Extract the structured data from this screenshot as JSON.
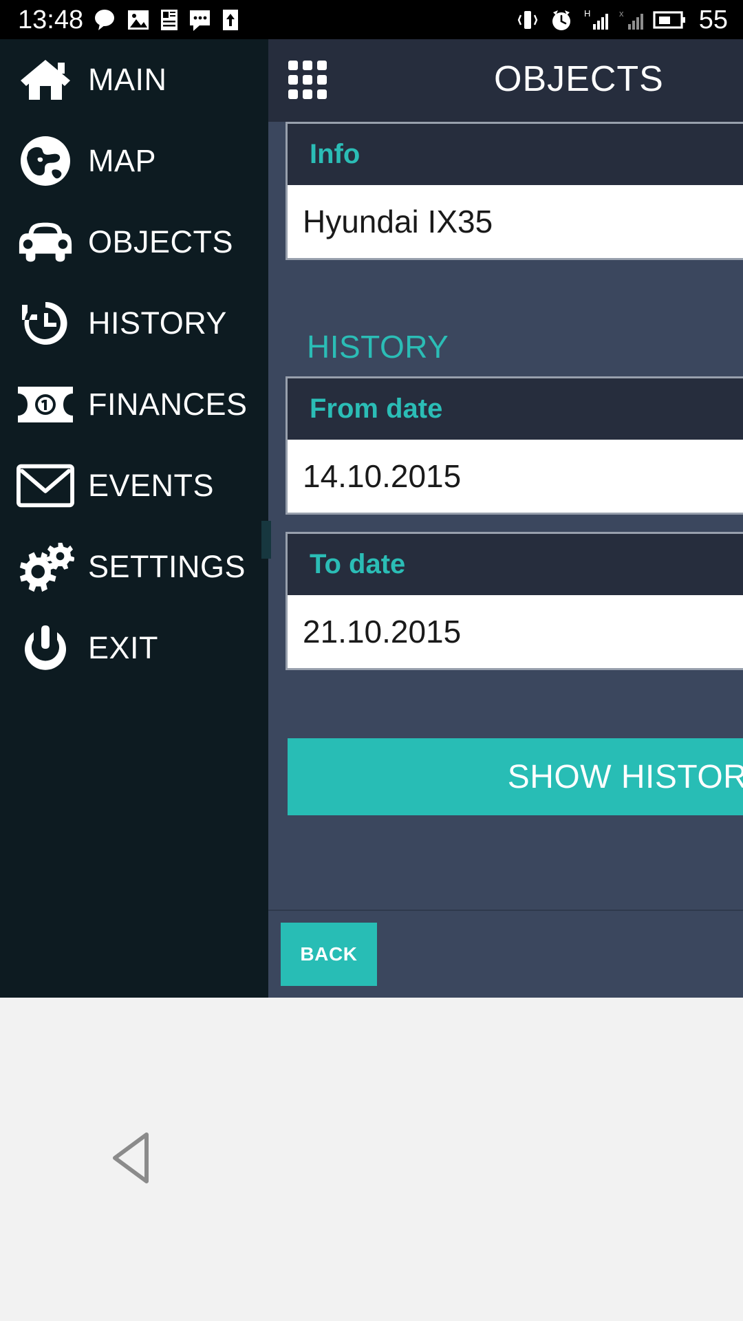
{
  "status_bar": {
    "time": "13:48",
    "battery_level": "55",
    "left_icons": [
      "chat-bubble-icon",
      "image-icon",
      "note-icon",
      "sms-icon",
      "upload-icon"
    ],
    "right_icons": [
      "vibrate-icon",
      "alarm-icon",
      "signal-h-icon",
      "signal-x-icon",
      "battery-icon"
    ]
  },
  "sidebar": {
    "items": [
      {
        "label": "MAIN",
        "icon": "home-icon"
      },
      {
        "label": "MAP",
        "icon": "globe-icon"
      },
      {
        "label": "OBJECTS",
        "icon": "car-icon"
      },
      {
        "label": "HISTORY",
        "icon": "history-clock-icon"
      },
      {
        "label": "FINANCES",
        "icon": "banknote-icon"
      },
      {
        "label": "EVENTS",
        "icon": "envelope-icon"
      },
      {
        "label": "SETTINGS",
        "icon": "gears-icon"
      },
      {
        "label": "EXIT",
        "icon": "power-icon"
      }
    ]
  },
  "panel": {
    "header": {
      "menu_icon": "grid-apps-icon",
      "title": "OBJECTS"
    },
    "info": {
      "label": "Info",
      "value": "Hyundai IX35"
    },
    "history_section_title": "HISTORY",
    "from_date": {
      "label": "From date",
      "value": "14.10.2015"
    },
    "to_date": {
      "label": "To date",
      "value": "21.10.2015"
    },
    "show_history_button": "SHOW HISTORY",
    "back_button": "BACK"
  },
  "system_nav": {
    "back_icon": "triangle-back-icon"
  },
  "colors": {
    "accent_teal": "#28bdb5",
    "sidebar_bg": "#0d1b21",
    "panel_bg": "#3b475e",
    "header_bg": "#262d3d",
    "field_border": "#98a0ad"
  }
}
